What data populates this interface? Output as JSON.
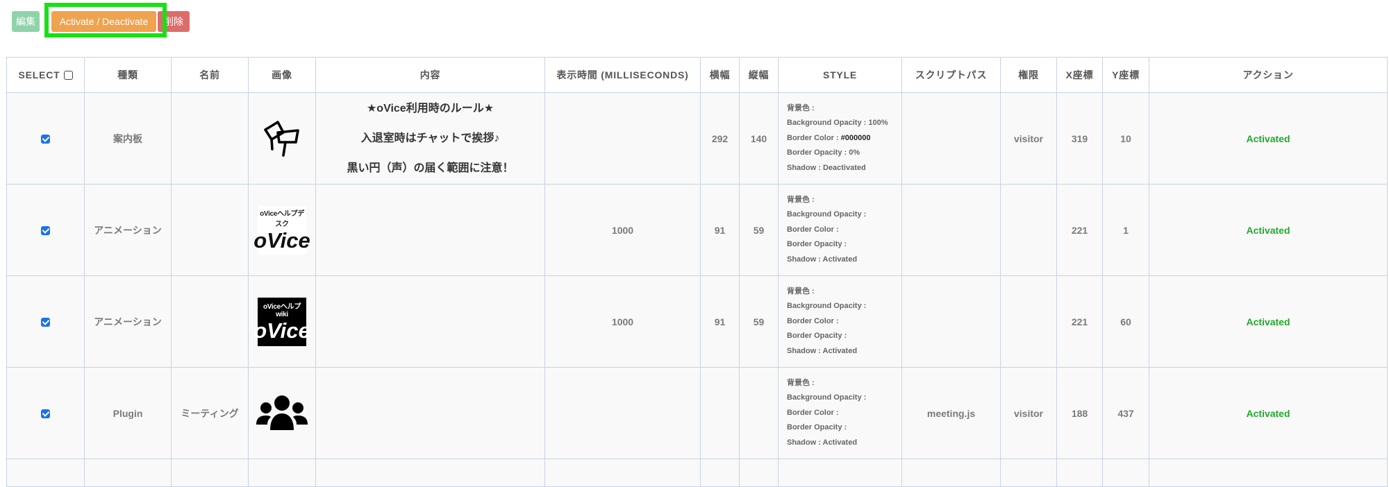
{
  "toolbar": {
    "edit_label": "編集",
    "activate_label": "Activate / Deactivate",
    "delete_label": "削除"
  },
  "colors": {
    "edit": "#8fd3a9",
    "activate": "#efa34e",
    "delete": "#db6d6a",
    "highlight": "#19e016",
    "activated_text": "#1faa2a",
    "checkbox": "#1a73e8"
  },
  "table": {
    "headers": {
      "select": "SELECT",
      "type": "種類",
      "name": "名前",
      "image": "画像",
      "content": "内容",
      "duration": "表示時間 (MILLISECONDS)",
      "width": "横幅",
      "height": "縦幅",
      "style": "STYLE",
      "script": "スクリプトパス",
      "permission": "権限",
      "x": "X座標",
      "y": "Y座標",
      "action": "アクション"
    },
    "rows": [
      {
        "checked": true,
        "type": "案内板",
        "name": "",
        "image_icon": "signboard-icon",
        "content": [
          "★oVice利用時のルール★",
          "入退室時はチャットで挨拶♪",
          "黒い円（声）の届く範囲に注意！"
        ],
        "duration": "",
        "width": "292",
        "height": "140",
        "style": {
          "bg": "背景色 :",
          "bg_opacity_label": "Background Opacity : ",
          "bg_opacity": "100%",
          "border_color_label": "Border Color : ",
          "border_color": "#000000",
          "border_opacity_label": "Border Opacity : ",
          "border_opacity": "0%",
          "shadow": "Shadow : Deactivated"
        },
        "script": "",
        "permission": "visitor",
        "x": "319",
        "y": "10",
        "action": "Activated"
      },
      {
        "checked": true,
        "type": "アニメーション",
        "name": "",
        "image_icon": "ovice-helpdesk-logo",
        "image_small": "oViceヘルプデスク",
        "image_big": "oVice",
        "content": [],
        "duration": "1000",
        "width": "91",
        "height": "59",
        "style": {
          "bg": "背景色 :",
          "bg_opacity_label": "Background Opacity : ",
          "bg_opacity": "",
          "border_color_label": "Border Color : ",
          "border_color": "",
          "border_opacity_label": "Border Opacity : ",
          "border_opacity": "",
          "shadow": "Shadow : Activated"
        },
        "script": "",
        "permission": "",
        "x": "221",
        "y": "1",
        "action": "Activated"
      },
      {
        "checked": true,
        "type": "アニメーション",
        "name": "",
        "image_icon": "ovice-helpwiki-logo",
        "image_small": "oViceヘルプwiki",
        "image_big": "oVice",
        "content": [],
        "duration": "1000",
        "width": "91",
        "height": "59",
        "style": {
          "bg": "背景色 :",
          "bg_opacity_label": "Background Opacity : ",
          "bg_opacity": "",
          "border_color_label": "Border Color : ",
          "border_color": "",
          "border_opacity_label": "Border Opacity : ",
          "border_opacity": "",
          "shadow": "Shadow : Activated"
        },
        "script": "",
        "permission": "",
        "x": "221",
        "y": "60",
        "action": "Activated"
      },
      {
        "checked": true,
        "type": "Plugin",
        "name": "ミーティング",
        "image_icon": "users-group-icon",
        "content": [],
        "duration": "",
        "width": "",
        "height": "",
        "style": {
          "bg": "背景色 :",
          "bg_opacity_label": "Background Opacity : ",
          "bg_opacity": "",
          "border_color_label": "Border Color : ",
          "border_color": "",
          "border_opacity_label": "Border Opacity : ",
          "border_opacity": "",
          "shadow": "Shadow : Activated"
        },
        "script": "meeting.js",
        "permission": "visitor",
        "x": "188",
        "y": "437",
        "action": "Activated"
      }
    ]
  }
}
